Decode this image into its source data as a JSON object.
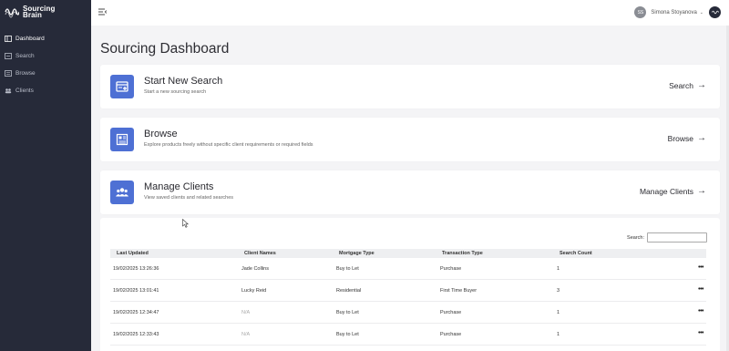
{
  "app": {
    "name_line1": "Sourcing",
    "name_line2": "Brain"
  },
  "sidebar": {
    "items": [
      {
        "label": "Dashboard",
        "icon": "dashboard-icon"
      },
      {
        "label": "Search",
        "icon": "search-list-icon"
      },
      {
        "label": "Browse",
        "icon": "browse-icon"
      },
      {
        "label": "Clients",
        "icon": "clients-icon"
      }
    ]
  },
  "header": {
    "user_initials": "SS",
    "user_name": "Simona Stoyanova"
  },
  "page": {
    "title": "Sourcing Dashboard"
  },
  "cards": [
    {
      "title": "Start New Search",
      "desc": "Start a new sourcing search",
      "link": "Search",
      "icon": "new-search-icon"
    },
    {
      "title": "Browse",
      "desc": "Explore products freely without specific client requirements or required fields",
      "link": "Browse",
      "icon": "browse-document-icon"
    },
    {
      "title": "Manage Clients",
      "desc": "View saved clients and related searches",
      "link": "Manage Clients",
      "icon": "group-icon"
    }
  ],
  "table": {
    "search_label": "Search:",
    "search_value": "",
    "columns": [
      "Last Updated",
      "Client Names",
      "Mortgage Type",
      "Transaction Type",
      "Search Count"
    ],
    "rows": [
      [
        "19/02/2025 13:26:36",
        "Jade Collins",
        "Buy to Let",
        "Purchase",
        "1"
      ],
      [
        "19/02/2025 13:01:41",
        "Lucky Reid",
        "Residential",
        "First Time Buyer",
        "3"
      ],
      [
        "19/02/2025 12:34:47",
        "N/A",
        "Buy to Let",
        "Purchase",
        "1"
      ],
      [
        "19/02/2025 12:33:43",
        "N/A",
        "Buy to Let",
        "Purchase",
        "1"
      ]
    ],
    "actions_label": "•••"
  },
  "colors": {
    "sidebar": "#262a39",
    "accent": "#4e70d4",
    "background": "#f4f4f6"
  }
}
